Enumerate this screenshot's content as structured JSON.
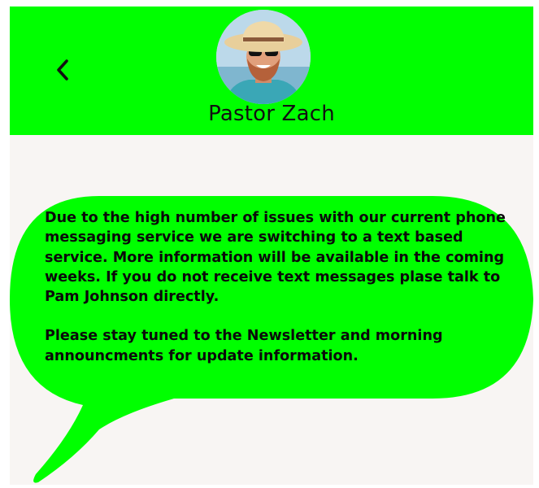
{
  "header": {
    "contact_name": "Pastor Zach",
    "back_icon": "chevron-left-icon",
    "background": "#00ff00"
  },
  "message": {
    "paragraph_1": "Due to the high number of issues with our current phone messaging service we are switching to a text based service. More information will be available in the coming weeks. If you do not receive text messages plase talk to Pam Johnson directly.",
    "paragraph_2": "Please stay tuned to the Newsletter and morning announcments for update information.",
    "bubble_color": "#00ff00"
  },
  "colors": {
    "accent": "#00ff00",
    "page_background": "#f8f5f3",
    "text": "#0a0a0a"
  }
}
